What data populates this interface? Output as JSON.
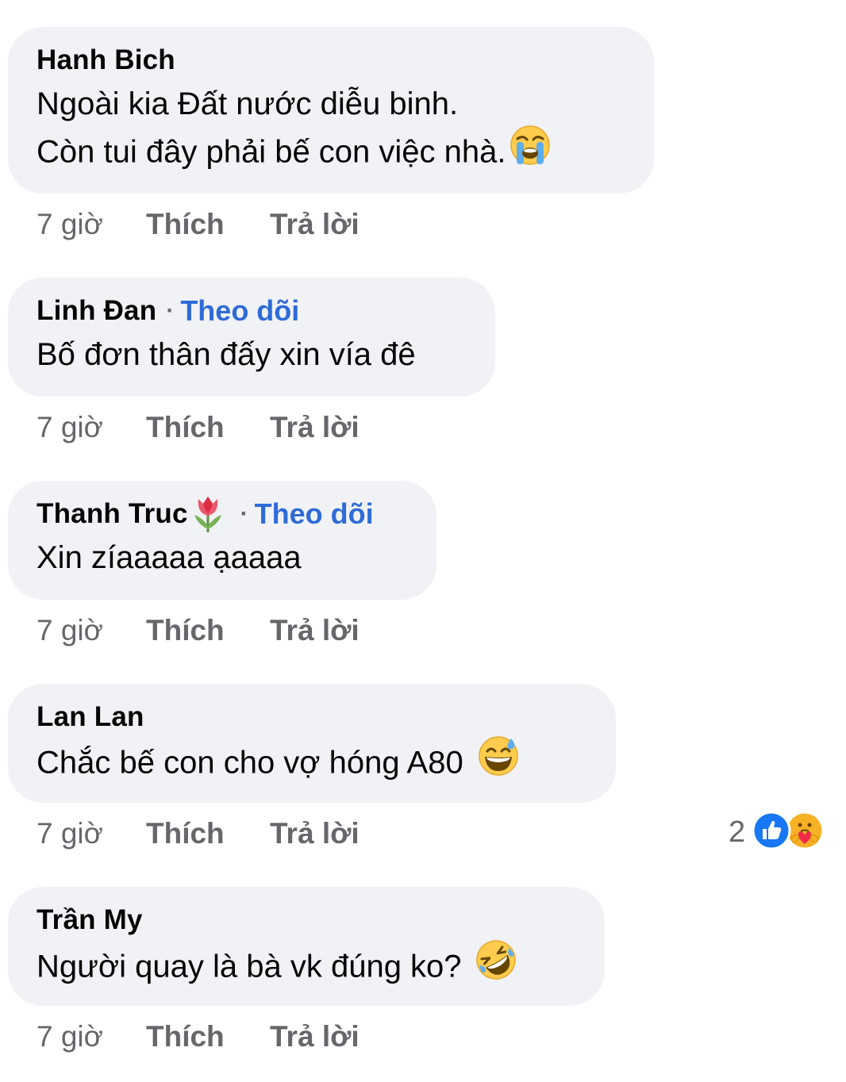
{
  "comments": [
    {
      "author": "Hanh Bich",
      "lines": [
        "Ngoài kia Đất nước diễu binh.",
        "Còn tui đây phải bế con việc nhà."
      ],
      "emoji": "loudly-crying-face-icon",
      "time": "7 giờ",
      "like": "Thích",
      "reply": "Trả lời"
    },
    {
      "author": "Linh Đan",
      "follow": "Theo dõi",
      "lines": [
        "Bố đơn thân đấy xin vía đê"
      ],
      "time": "7 giờ",
      "like": "Thích",
      "reply": "Trả lời"
    },
    {
      "author": "Thanh Truc",
      "author_emoji": "tulip-icon",
      "follow": "Theo dõi",
      "lines": [
        "Xin zíaaaaa ạaaaa"
      ],
      "time": "7 giờ",
      "like": "Thích",
      "reply": "Trả lời"
    },
    {
      "author": "Lan Lan",
      "lines": [
        "Chắc bế con cho vợ hóng A80"
      ],
      "emoji": "grinning-sweat-face-icon",
      "time": "7 giờ",
      "like": "Thích",
      "reply": "Trả lời",
      "reactions": {
        "count": "2",
        "types": [
          "like-reaction-icon",
          "care-reaction-icon"
        ]
      }
    },
    {
      "author": "Trần My",
      "lines": [
        "Người quay là bà vk đúng ko?"
      ],
      "emoji": "rolling-laughing-face-icon",
      "time": "7 giờ",
      "like": "Thích",
      "reply": "Trả lời"
    }
  ],
  "colors": {
    "bubble": "#f0f2f5",
    "text": "#050505",
    "meta": "#65676b",
    "follow": "#2f6bd8",
    "like_reaction": "#1877f2"
  }
}
